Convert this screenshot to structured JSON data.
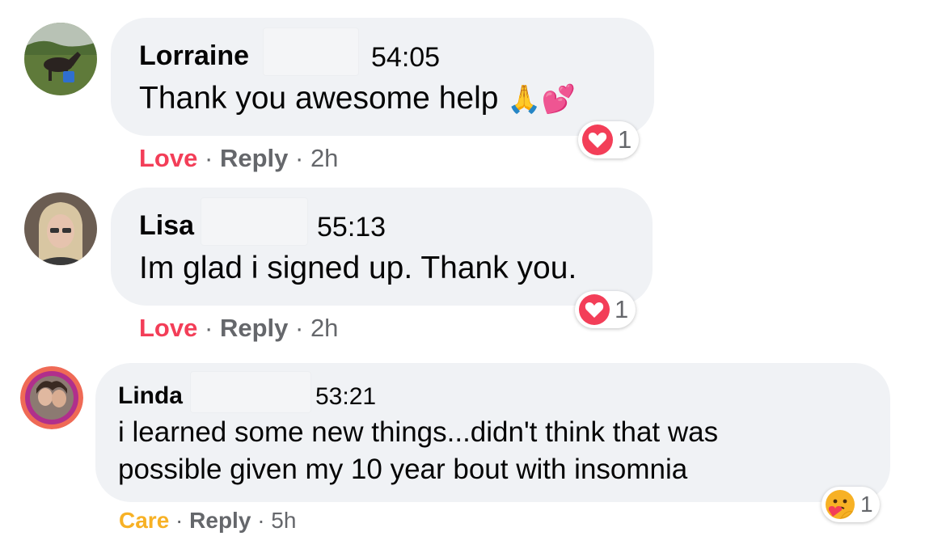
{
  "comments": [
    {
      "author": "Lorraine",
      "timestamp": "54:05",
      "text": "Thank you awesome help",
      "emoji": "🙏💕",
      "reaction_action": "Love",
      "reaction_action_color": "#f33e58",
      "reply_label": "Reply",
      "age": "2h",
      "reaction_icon": "heart-icon",
      "reaction_count": "1"
    },
    {
      "author": "Lisa",
      "timestamp": "55:13",
      "text": "Im glad i signed up. Thank you.",
      "reaction_action": "Love",
      "reaction_action_color": "#f33e58",
      "reply_label": "Reply",
      "age": "2h",
      "reaction_icon": "heart-icon",
      "reaction_count": "1"
    },
    {
      "author": "Linda",
      "timestamp": "53:21",
      "text_line1": "i learned some new things...didn't think that was",
      "text_line2": "possible given my 10 year bout with insomnia",
      "reaction_action": "Care",
      "reaction_action_color": "#f7b125",
      "reply_label": "Reply",
      "age": "5h",
      "reaction_icon": "care-emoji-icon",
      "reaction_count": "1"
    }
  ],
  "separator": "·",
  "colors": {
    "bubble": "#f0f2f5",
    "secondary_text": "#65676b",
    "love": "#f33e58",
    "care": "#f7b125"
  }
}
